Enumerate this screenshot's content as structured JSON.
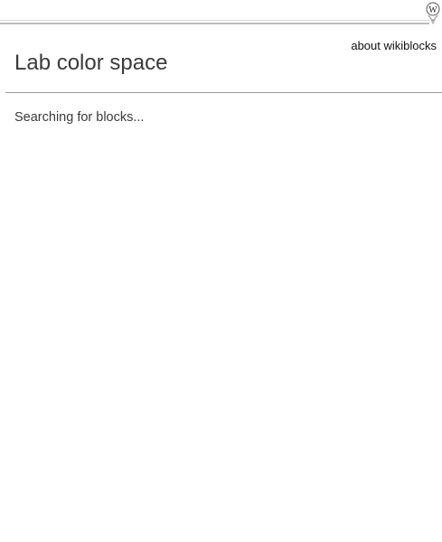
{
  "header": {
    "about_label": "about wikiblocks",
    "badge_icon": "wikipedia-w-icon"
  },
  "page": {
    "title": "Lab color space",
    "status": "Searching for blocks..."
  }
}
